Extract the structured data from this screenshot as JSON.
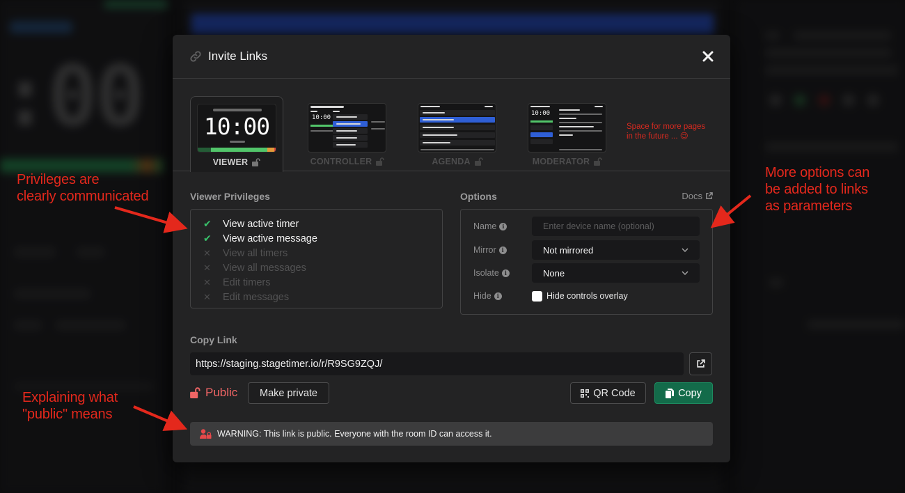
{
  "modal": {
    "title": "Invite Links",
    "title_icon": "link-icon",
    "close_icon": "close-icon"
  },
  "tabs": [
    {
      "label": "VIEWER",
      "active": true,
      "icon": "unlock-icon",
      "thumb_time": "10:00"
    },
    {
      "label": "CONTROLLER",
      "active": false,
      "icon": "unlock-icon",
      "thumb_time": "10:00"
    },
    {
      "label": "AGENDA",
      "active": false,
      "icon": "unlock-icon"
    },
    {
      "label": "MODERATOR",
      "active": false,
      "icon": "unlock-icon",
      "thumb_time": "10:00"
    }
  ],
  "future_note": {
    "line1": "Space for more pages",
    "line2": "in the future ... 😉"
  },
  "privileges": {
    "title": "Viewer Privileges",
    "items": [
      {
        "label": "View active timer",
        "allowed": true
      },
      {
        "label": "View active message",
        "allowed": true
      },
      {
        "label": "View all timers",
        "allowed": false
      },
      {
        "label": "View all messages",
        "allowed": false
      },
      {
        "label": "Edit timers",
        "allowed": false
      },
      {
        "label": "Edit messages",
        "allowed": false
      }
    ],
    "allowed_glyph": "✔",
    "denied_glyph": "✕"
  },
  "options": {
    "title": "Options",
    "docs_label": "Docs",
    "name": {
      "label": "Name",
      "placeholder": "Enter device name (optional)",
      "value": ""
    },
    "mirror": {
      "label": "Mirror",
      "value": "Not mirrored"
    },
    "isolate": {
      "label": "Isolate",
      "value": "None"
    },
    "hide": {
      "label": "Hide",
      "checkbox_label": "Hide controls overlay",
      "checked": false
    }
  },
  "copy_link": {
    "title": "Copy Link",
    "url": "https://staging.stagetimer.io/r/R9SG9ZQJ/",
    "visibility": "Public",
    "make_private_label": "Make private",
    "qr_label": "QR Code",
    "copy_label": "Copy"
  },
  "warning": {
    "text": "WARNING: This link is public. Everyone with the room ID can access it."
  },
  "annotations": {
    "privileges": {
      "line1": "Privileges are",
      "line2": "clearly communicated"
    },
    "options": {
      "line1": "More options can",
      "line2": "be added to links",
      "line3": "as parameters"
    },
    "public": {
      "line1": "Explaining what",
      "line2": "\"public\" means"
    }
  },
  "colors": {
    "accent_green": "#136b4a",
    "allowed_check": "#39c26b",
    "public_red": "#f06565",
    "annotation_red": "#e4281c",
    "selected_blue": "#2f5fd6"
  }
}
